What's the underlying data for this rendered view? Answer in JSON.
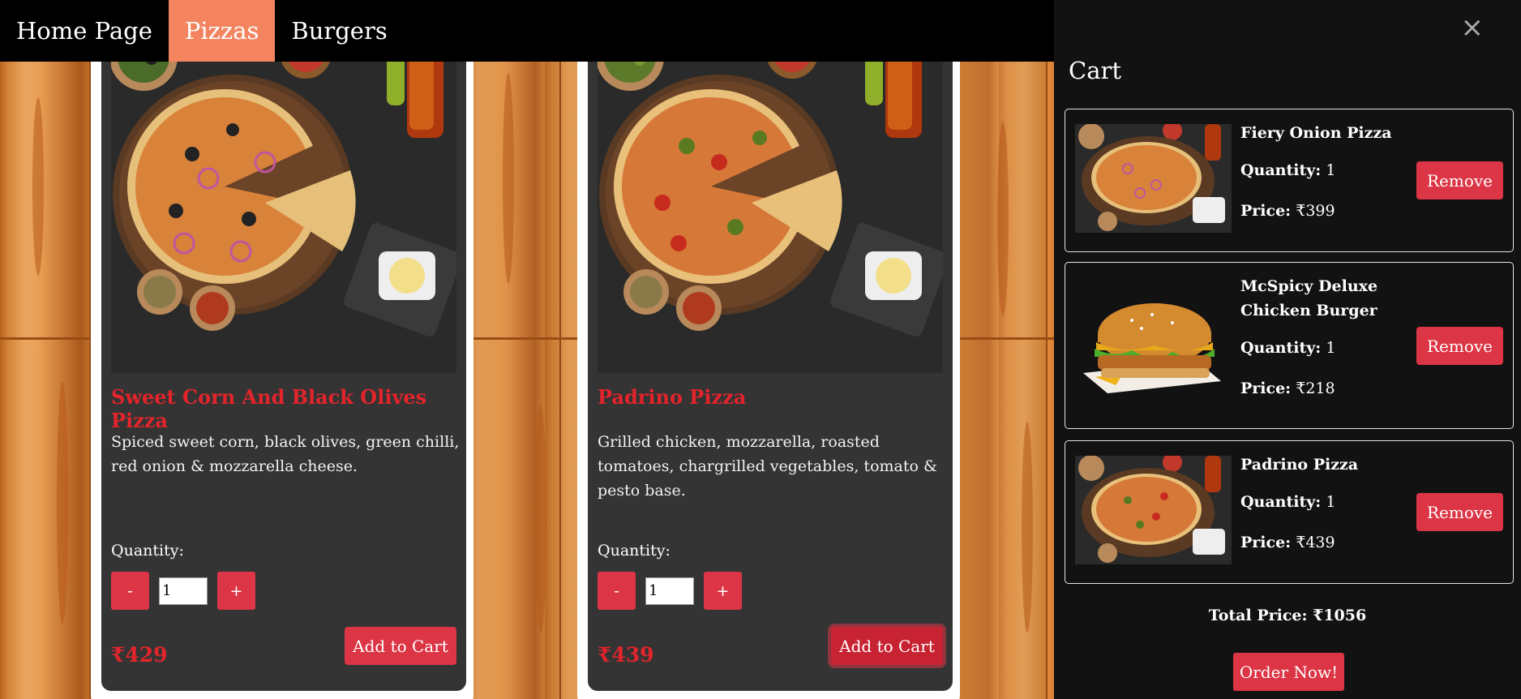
{
  "nav": {
    "items": [
      {
        "label": "Home Page",
        "active": false
      },
      {
        "label": "Pizzas",
        "active": true
      },
      {
        "label": "Burgers",
        "active": false
      }
    ],
    "active_color": "#f4845f"
  },
  "products": [
    {
      "title": "Sweet Corn And Black Olives Pizza",
      "description": "Spiced sweet corn, black olives, green chilli, red onion & mozzarella cheese.",
      "quantity_label": "Quantity:",
      "quantity_value": "1",
      "minus_label": "-",
      "plus_label": "+",
      "price": "₹429",
      "add_label": "Add to Cart",
      "image_icon": "pizza-photo"
    },
    {
      "title": "Padrino Pizza",
      "description": "Grilled chicken, mozzarella, roasted tomatoes, chargrilled vegetables, tomato & pesto base.",
      "quantity_label": "Quantity:",
      "quantity_value": "1",
      "minus_label": "-",
      "plus_label": "+",
      "price": "₹439",
      "add_label": "Add to Cart",
      "image_icon": "pizza-photo"
    }
  ],
  "cart": {
    "title": "Cart",
    "close_label": "×",
    "items": [
      {
        "name": "Fiery Onion Pizza",
        "quantity_label": "Quantity:",
        "quantity": " 1",
        "price_label": "Price:",
        "price": " ₹399",
        "remove_label": "Remove"
      },
      {
        "name": "McSpicy Deluxe Chicken Burger",
        "quantity_label": "Quantity:",
        "quantity": " 1",
        "price_label": "Price:",
        "price": " ₹218",
        "remove_label": "Remove"
      },
      {
        "name": "Padrino Pizza",
        "quantity_label": "Quantity:",
        "quantity": " 1",
        "price_label": "Price:",
        "price": " ₹439",
        "remove_label": "Remove"
      }
    ],
    "total": "Total Price: ₹1056",
    "order_label": "Order Now!"
  },
  "colors": {
    "accent_red": "#dc3545",
    "title_red": "#e3242b",
    "card_bg": "#343434",
    "cart_bg": "#121212"
  }
}
